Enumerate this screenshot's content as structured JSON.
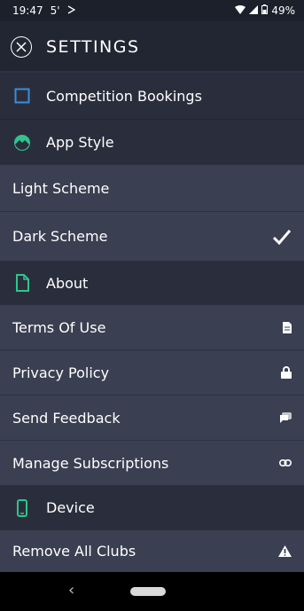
{
  "status_bar": {
    "time": "19:47",
    "indicator": "5'",
    "battery": "49%",
    "icons": [
      "play-icon",
      "wifi-icon",
      "signal-icon",
      "battery-icon"
    ]
  },
  "header": {
    "title": "SETTINGS",
    "close_icon": "close-icon"
  },
  "sections": {
    "competition": {
      "label": "Competition Bookings",
      "icon": "checkbox-icon",
      "icon_color": "#3a8ed6"
    },
    "app_style": {
      "label": "App Style",
      "icon": "landscape-icon",
      "icon_color": "#31c48d"
    },
    "about": {
      "label": "About",
      "icon": "document-icon",
      "icon_color": "#31c48d"
    },
    "device": {
      "label": "Device",
      "icon": "phone-icon",
      "icon_color": "#31c48d"
    }
  },
  "items": {
    "light_scheme": {
      "label": "Light Scheme"
    },
    "dark_scheme": {
      "label": "Dark Scheme",
      "checked": true
    },
    "terms": {
      "label": "Terms Of Use",
      "icon": "document-icon"
    },
    "privacy": {
      "label": "Privacy Policy",
      "icon": "lock-icon"
    },
    "feedback": {
      "label": "Send Feedback",
      "icon": "chat-icon"
    },
    "subscriptions": {
      "label": "Manage Subscriptions",
      "icon": "link-icon"
    },
    "remove_clubs": {
      "label": "Remove All Clubs",
      "icon": "warning-icon"
    }
  },
  "colors": {
    "background": "#1b1f2a",
    "section_bg": "#2a2e3c",
    "item_bg": "#3a3f51",
    "accent_green": "#31c48d",
    "accent_blue": "#3a8ed6"
  },
  "nav_bar": {
    "back": "‹"
  }
}
